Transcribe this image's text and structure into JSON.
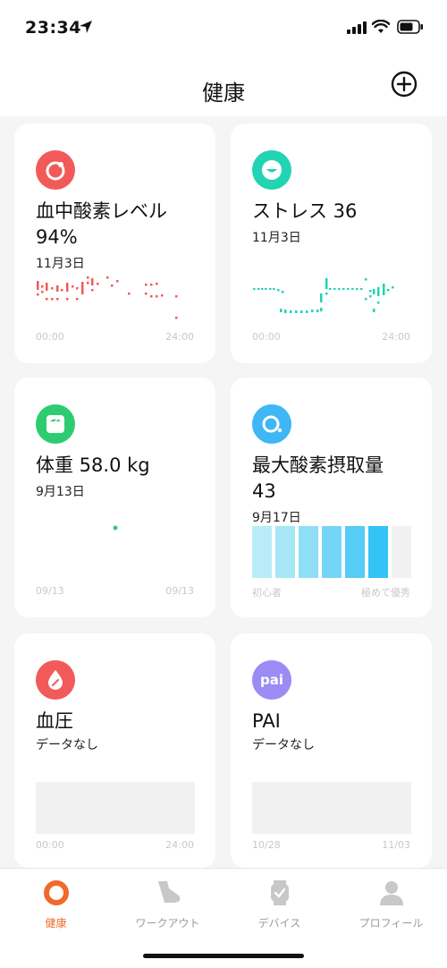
{
  "status": {
    "time": "23:34"
  },
  "header": {
    "title": "健康",
    "add_icon": "plus-circle-icon"
  },
  "cards": {
    "spo2": {
      "title": "血中酸素レベル",
      "value": "94%",
      "date": "11月3日",
      "axis_start": "00:00",
      "axis_end": "24:00",
      "icon": "circle-target-icon",
      "color": "#f25a5a"
    },
    "stress": {
      "title": "ストレス 36",
      "date": "11月3日",
      "axis_start": "00:00",
      "axis_end": "24:00",
      "icon": "smile-face-icon",
      "color": "#22d3b4"
    },
    "weight": {
      "title": "体重 58.0 kg",
      "date": "9月13日",
      "axis_start": "09/13",
      "axis_end": "09/13",
      "icon": "scale-icon",
      "color": "#2ecc71"
    },
    "vo2max": {
      "title": "最大酸素摂取量",
      "value": "43",
      "date": "9月17日",
      "axis_start": "初心者",
      "axis_end": "極めて優秀",
      "level": 6,
      "level_max": 7,
      "icon": "vo2-icon",
      "color": "#3fb6f5"
    },
    "blood_pressure": {
      "title": "血圧",
      "subtitle": "データなし",
      "axis_start": "00:00",
      "axis_end": "24:00",
      "icon": "drop-icon",
      "color": "#f25a5a"
    },
    "pai": {
      "title": "PAI",
      "subtitle": "データなし",
      "axis_start": "10/28",
      "axis_end": "11/03",
      "icon_text": "pai",
      "color": "#9b8cf5"
    }
  },
  "tabs": [
    {
      "label": "健康",
      "icon": "health-ring-icon",
      "active": true
    },
    {
      "label": "ワークアウト",
      "icon": "shoe-icon",
      "active": false
    },
    {
      "label": "デバイス",
      "icon": "watch-icon",
      "active": false
    },
    {
      "label": "プロフィール",
      "icon": "person-icon",
      "active": false
    }
  ]
}
